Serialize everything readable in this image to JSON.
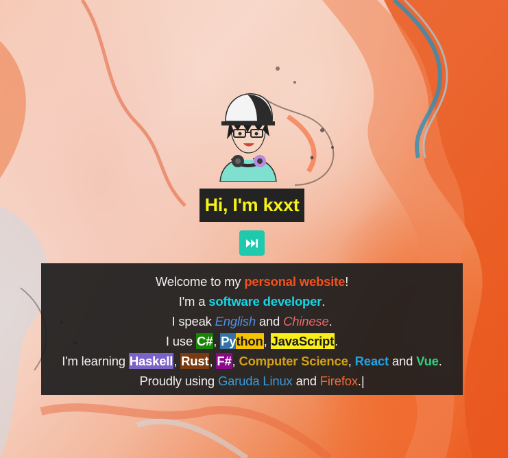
{
  "hero": {
    "greeting": "Hi, I'm kxxt"
  },
  "controls": {
    "skip_icon": "skip-forward-icon"
  },
  "intro": {
    "line1": {
      "pre": "Welcome to my ",
      "highlight": "personal website",
      "post": "!"
    },
    "line2": {
      "pre": "I'm a ",
      "highlight": "software developer",
      "post": "."
    },
    "line3": {
      "pre": "I speak ",
      "lang1": "English",
      "mid": " and ",
      "lang2": "Chinese",
      "post": "."
    },
    "line4": {
      "pre": "I use ",
      "csharp": "C#",
      "sep1": ", ",
      "python_a": "Py",
      "python_b": "thon",
      "sep2": ", ",
      "javascript": "JavaScript",
      "post": "."
    },
    "line5": {
      "pre": "I'm learning ",
      "haskell": "Haskell",
      "sep1": ", ",
      "rust": "Rust",
      "sep2": ", ",
      "fsharp": "F#",
      "sep3": ", ",
      "cs": "Computer Science",
      "sep4": ", ",
      "react": "React",
      "mid": " and ",
      "vue": "Vue",
      "post": "."
    },
    "line6": {
      "pre": "Proudly using ",
      "garuda": "Garuda Linux",
      "mid": " and ",
      "firefox": "Firefox",
      "post": ".",
      "cursor": "|"
    }
  },
  "colors": {
    "greeting": "#f7f21a",
    "accent_orange": "#f4511e",
    "accent_cyan": "#16d5e6",
    "english": "#4f8fe6",
    "chinese": "#e86a6a",
    "csharp_bg": "#178600",
    "python_bg1": "#3572a5",
    "python_bg2": "#f7c300",
    "javascript_bg": "#f1e05a",
    "haskell_bg": "#7a62c9",
    "rust_bg": "#7a3b10",
    "fsharp_bg": "#8b0a8b",
    "cs": "#d4a017",
    "react": "#1fa3e8",
    "vue": "#2ed07d",
    "garuda": "#3a9ad9",
    "firefox": "#f26b3a",
    "skip_button": "#1ec9ad"
  }
}
